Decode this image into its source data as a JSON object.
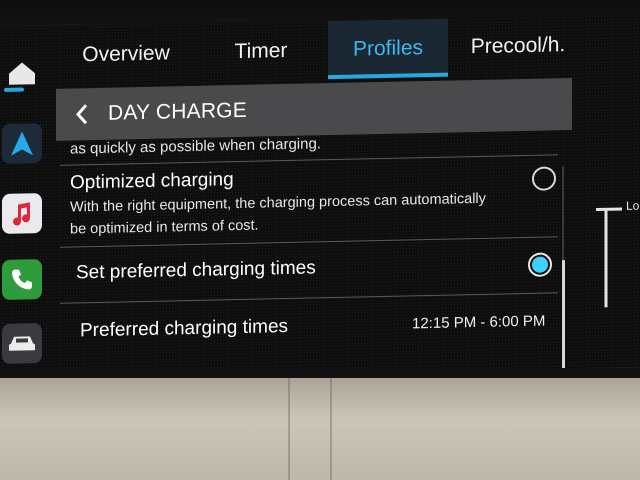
{
  "tabs": [
    {
      "label": "Overview"
    },
    {
      "label": "Timer"
    },
    {
      "label": "Profiles"
    },
    {
      "label": "Precool/h."
    }
  ],
  "header": {
    "title": "DAY CHARGE"
  },
  "list": {
    "cut_off_text": "as quickly as possible when charging.",
    "optimized": {
      "title": "Optimized charging",
      "description": "With the right equipment, the charging process can automatically be optimized in terms of cost.",
      "selected": false
    },
    "preferred_times_option": {
      "title": "Set preferred charging times",
      "selected": true
    },
    "preferred_times": {
      "label": "Preferred charging times",
      "value": "12:15 PM - 6:00 PM"
    }
  },
  "edge_text": "Lo",
  "colors": {
    "accent": "#27a9e0",
    "radio_selected": "#3fd0ff",
    "header_bg": "#4a4a4c"
  },
  "icons": [
    "home-icon",
    "navigation-icon",
    "music-icon",
    "phone-icon",
    "car-icon",
    "chevron-left-icon"
  ]
}
